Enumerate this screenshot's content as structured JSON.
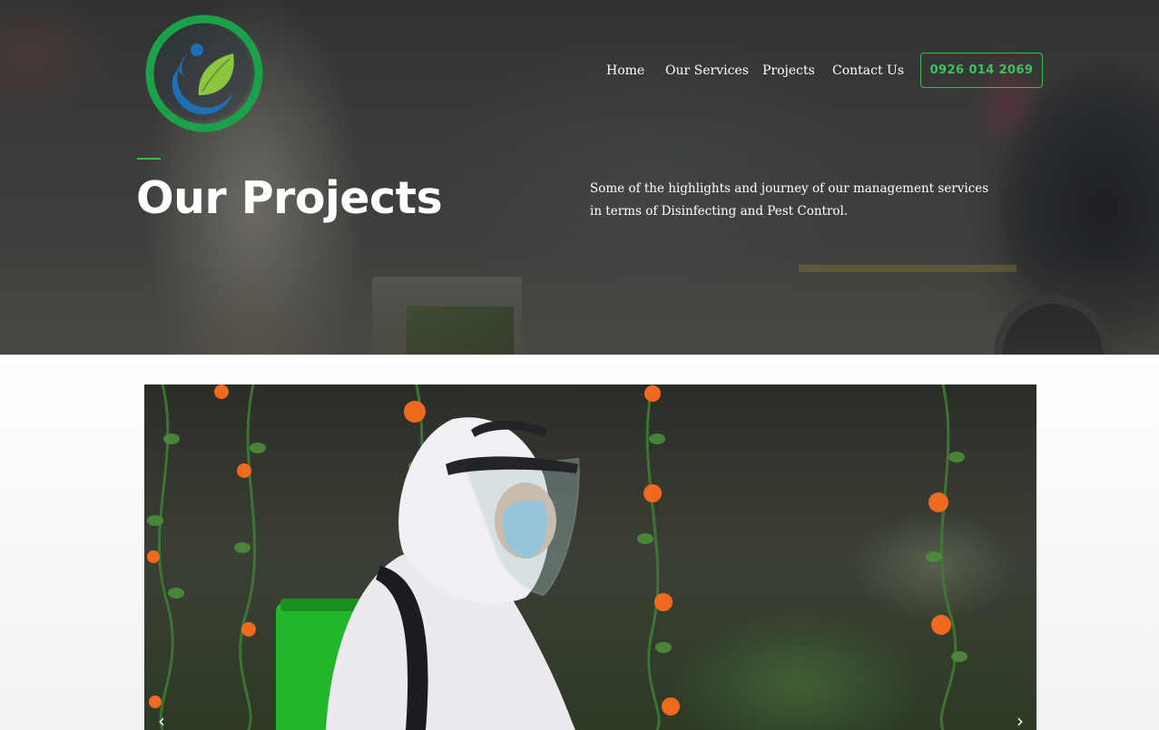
{
  "header": {
    "logo_name": "eco-pro-logo",
    "nav": [
      {
        "label": "Home"
      },
      {
        "label": "Our Services"
      },
      {
        "label": "Projects"
      },
      {
        "label": "Contact Us"
      }
    ],
    "phone_button": "0926 014 2069"
  },
  "hero": {
    "title": "Our Projects",
    "description": "Some of the highlights and journey of our management services in terms of Disinfecting and Pest Control."
  },
  "slider": {
    "prev_icon": "chevron-left-icon",
    "next_icon": "chevron-right-icon",
    "prev_glyph": "‹",
    "next_glyph": "›"
  },
  "colors": {
    "accent_green": "#2fbf4f",
    "logo_blue": "#1e6fb4",
    "logo_leaf": "#8cc63f"
  }
}
